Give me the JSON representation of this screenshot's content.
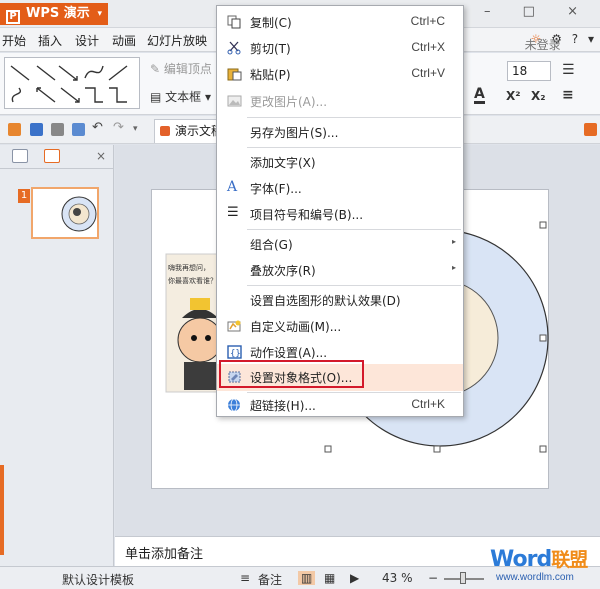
{
  "app": {
    "title": "WPS 演示",
    "logo_glyph": "P",
    "menu_arrow": "▾",
    "window_controls": "– □ ×"
  },
  "menubar": {
    "items": [
      "开始",
      "插入",
      "设计",
      "动画",
      "幻灯片放映"
    ],
    "login": "未登录",
    "help": "?",
    "more": "▾"
  },
  "ribbon": {
    "edit_vertices": "编辑顶点",
    "text_box": "文本框",
    "font_size": "18",
    "text_color_glyph": "A",
    "superscript": "X²",
    "subscript": "X₂"
  },
  "quickbar": {
    "doc_tab": "演示文稿"
  },
  "left_panel": {
    "slide_number": "1",
    "close": "×"
  },
  "slide": {
    "image_text_line1": "嗨我再想问，",
    "image_text_line2": "你最喜欢看谁？"
  },
  "notes": {
    "placeholder": "单击添加备注"
  },
  "statusbar": {
    "template": "默认设计模板",
    "notes_btn": "备注",
    "zoom": "43 %",
    "zoom_minus": "−",
    "zoom_plus": "+"
  },
  "watermark": {
    "brand": "Word",
    "brand_cn": "联盟",
    "url": "www.wordlm.com"
  },
  "context_menu": {
    "items": [
      {
        "label": "复制(C)",
        "shortcut": "Ctrl+C",
        "icon": "copy-icon"
      },
      {
        "label": "剪切(T)",
        "shortcut": "Ctrl+X",
        "icon": "scissors-icon"
      },
      {
        "label": "粘贴(P)",
        "shortcut": "Ctrl+V",
        "icon": "paste-icon"
      },
      {
        "label": "更改图片(A)...",
        "shortcut": "",
        "icon": "change-picture-icon"
      },
      {
        "label": "另存为图片(S)...",
        "shortcut": "",
        "icon": ""
      },
      {
        "label": "添加文字(X)",
        "shortcut": "",
        "icon": ""
      },
      {
        "label": "字体(F)...",
        "shortcut": "",
        "icon": "font-icon"
      },
      {
        "label": "项目符号和编号(B)...",
        "shortcut": "",
        "icon": "bullets-icon"
      },
      {
        "label": "组合(G)",
        "shortcut": "",
        "icon": ""
      },
      {
        "label": "叠放次序(R)",
        "shortcut": "",
        "icon": ""
      },
      {
        "label": "设置自选图形的默认效果(D)",
        "shortcut": "",
        "icon": ""
      },
      {
        "label": "自定义动画(M)...",
        "shortcut": "",
        "icon": "custom-animation-icon"
      },
      {
        "label": "动作设置(A)...",
        "shortcut": "",
        "icon": "action-settings-icon"
      },
      {
        "label": "设置对象格式(O)...",
        "shortcut": "",
        "icon": "format-object-icon"
      },
      {
        "label": "超链接(H)...",
        "shortcut": "Ctrl+K",
        "icon": "hyperlink-icon"
      }
    ],
    "submenu_arrow": "▸"
  },
  "colors": {
    "accent": "#e35d18",
    "highlight": "#fde6d9",
    "red_frame": "#d3192b",
    "donut_fill": "#d9e4f5"
  }
}
